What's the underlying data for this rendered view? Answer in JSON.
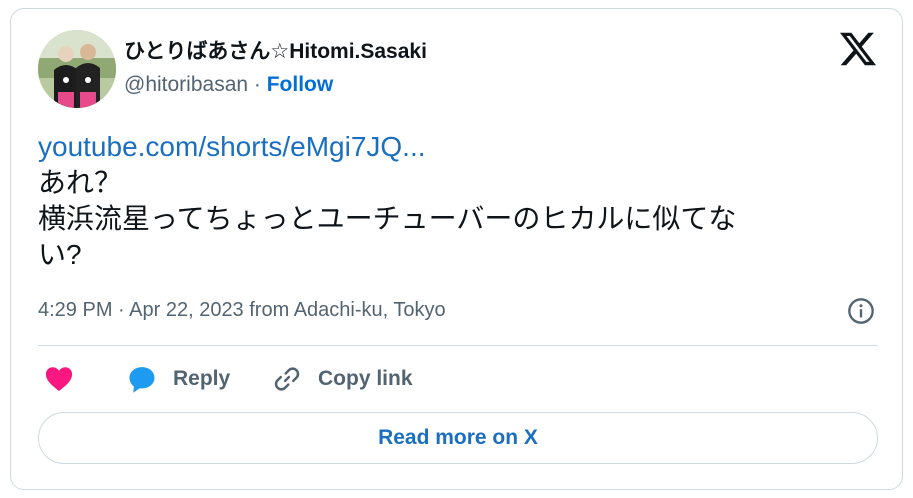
{
  "author": {
    "display_name": "ひとりばあさん☆Hitomi.Sasaki",
    "handle": "@hitoribasan",
    "separator": " · ",
    "follow_label": "Follow"
  },
  "tweet": {
    "link_text": "youtube.com/shorts/eMgi7JQ...",
    "lines": [
      "あれ？",
      "横浜流星ってちょっとユーチューバーのヒカルに似てな",
      "い?"
    ]
  },
  "meta": {
    "timestamp": "4:29 PM · Apr 22, 2023 from Adachi-ku, Tokyo"
  },
  "actions": {
    "reply_label": "Reply",
    "copy_link_label": "Copy link"
  },
  "read_more_label": "Read more on X",
  "colors": {
    "like": "#f91880",
    "reply": "#1d9bf0",
    "link": "#1b6fc2",
    "follow": "#006fd6",
    "muted": "#536471",
    "border": "#cfd9de"
  },
  "icons": [
    "avatar-photo",
    "x-logo-icon",
    "info-icon",
    "heart-icon",
    "reply-bubble-icon",
    "link-icon"
  ]
}
